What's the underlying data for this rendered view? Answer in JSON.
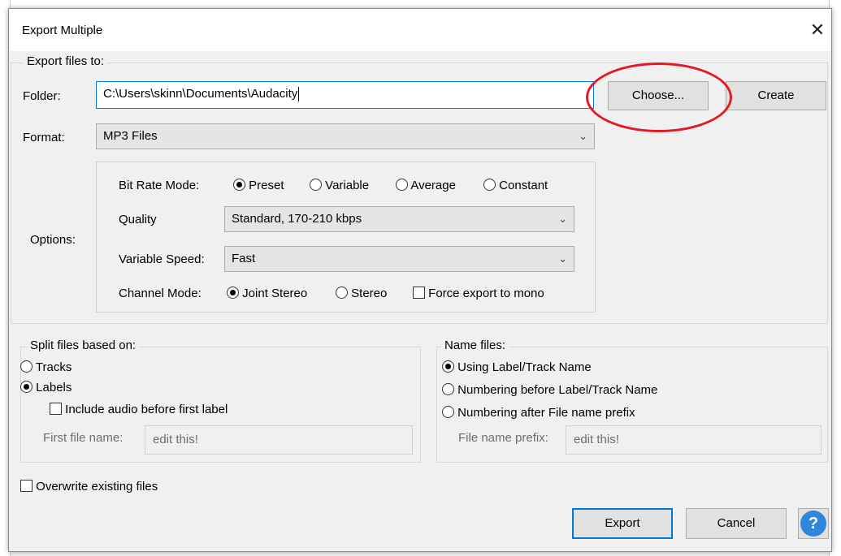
{
  "dialog": {
    "title": "Export Multiple",
    "close_glyph": "✕"
  },
  "export_to": {
    "legend": "Export files to:",
    "folder_label": "Folder:",
    "folder_value": "C:\\Users\\skinn\\Documents\\Audacity",
    "choose_label": "Choose...",
    "create_label": "Create",
    "format_label": "Format:",
    "format_value": "MP3 Files",
    "options_label": "Options:"
  },
  "options": {
    "bit_rate_label": "Bit Rate Mode:",
    "bit_rate_modes": [
      "Preset",
      "Variable",
      "Average",
      "Constant"
    ],
    "bit_rate_selected": "Preset",
    "quality_label": "Quality",
    "quality_value": "Standard, 170-210 kbps",
    "speed_label": "Variable Speed:",
    "speed_value": "Fast",
    "channel_label": "Channel Mode:",
    "channel_modes": [
      "Joint Stereo",
      "Stereo"
    ],
    "channel_selected": "Joint Stereo",
    "force_mono_label": "Force export to mono",
    "force_mono_checked": false
  },
  "split": {
    "legend": "Split files based on:",
    "tracks_label": "Tracks",
    "labels_label": "Labels",
    "selected": "Labels",
    "include_audio_label": "Include audio before first label",
    "include_audio_checked": false,
    "first_file_label": "First file name:",
    "first_file_value": "edit this!"
  },
  "name_files": {
    "legend": "Name files:",
    "options": [
      "Using Label/Track Name",
      "Numbering before Label/Track Name",
      "Numbering after File name prefix"
    ],
    "selected": "Using Label/Track Name",
    "prefix_label": "File name prefix:",
    "prefix_value": "edit this!"
  },
  "overwrite": {
    "label": "Overwrite existing files",
    "checked": false
  },
  "footer": {
    "export_label": "Export",
    "cancel_label": "Cancel",
    "help_glyph": "?"
  },
  "colors": {
    "annotation": "#e01b24",
    "focus": "#0078d7",
    "help": "#2e86de"
  }
}
